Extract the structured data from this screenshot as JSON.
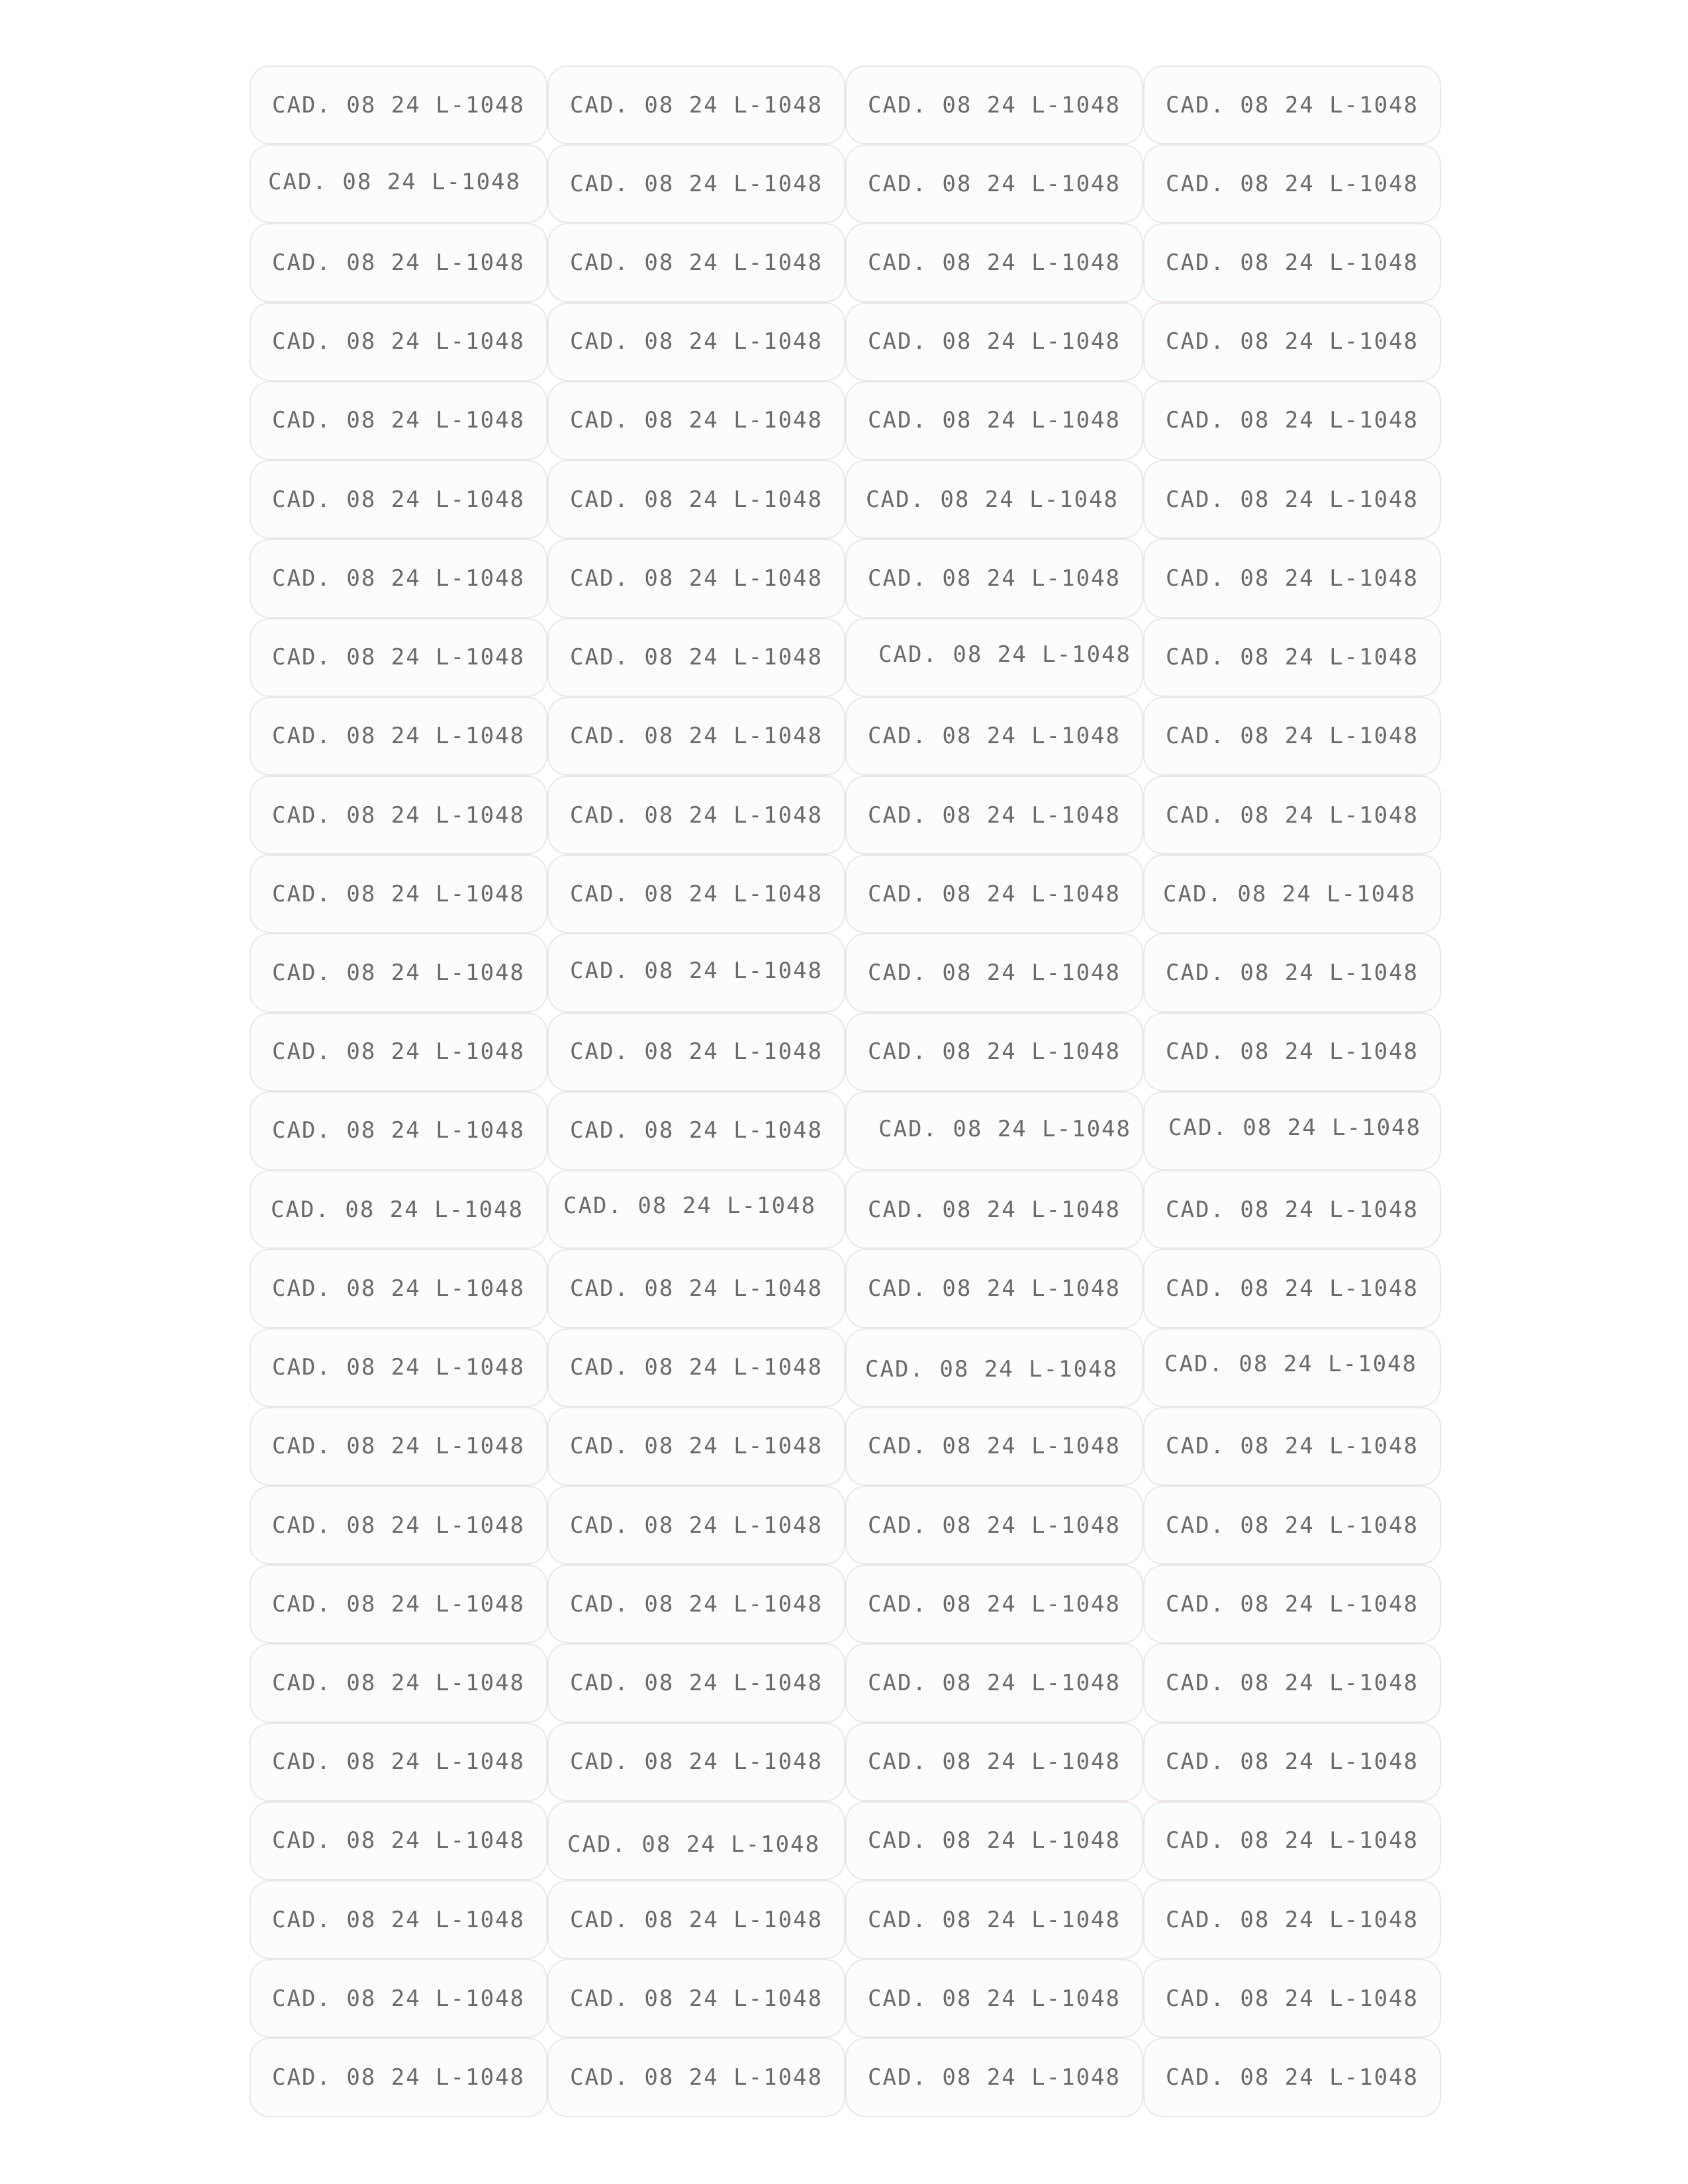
{
  "label_sheet": {
    "columns": 4,
    "rows": 26,
    "label_text": "CAD. 08 24 L-1048"
  }
}
